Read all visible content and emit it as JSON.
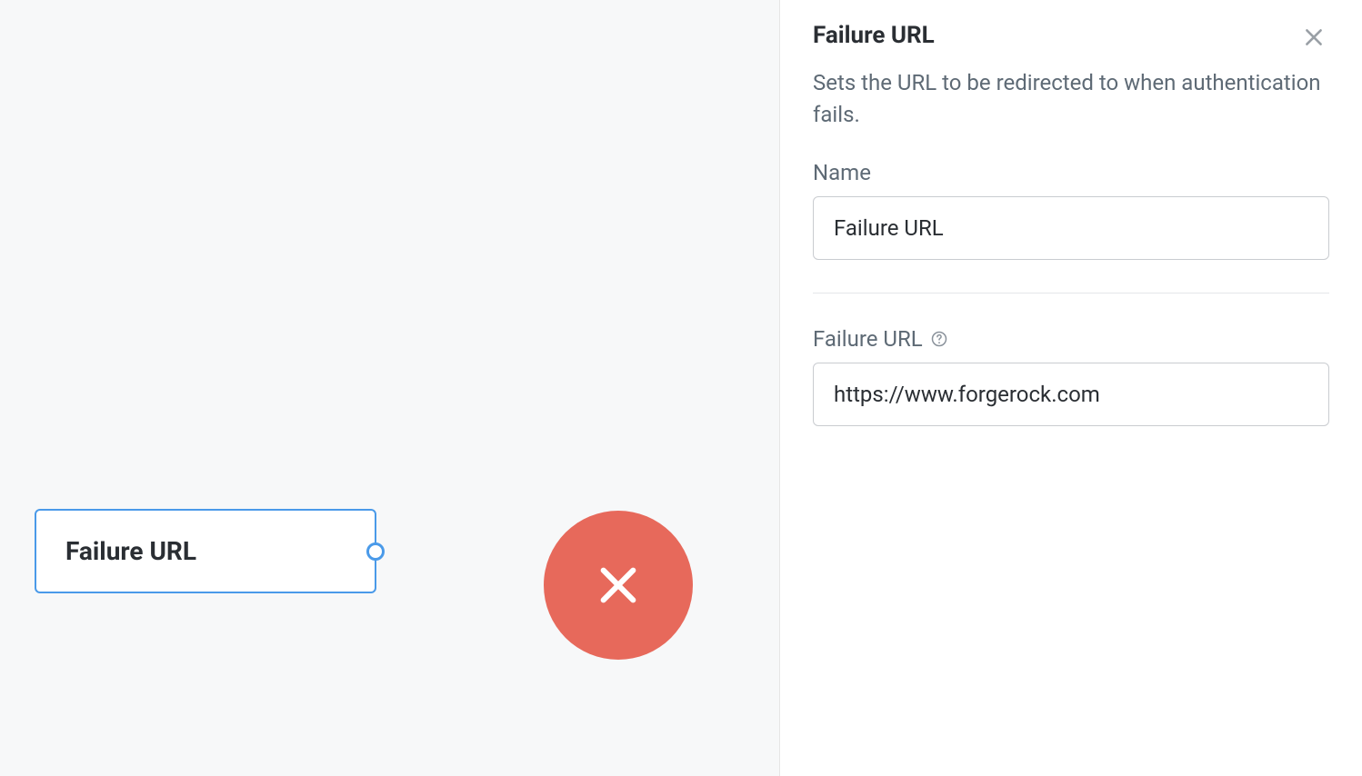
{
  "panel": {
    "title": "Failure URL",
    "description": "Sets the URL to be redirected to when authentication fails.",
    "name_label": "Name",
    "name_value": "Failure URL",
    "url_label": "Failure URL",
    "url_value": "https://www.forgerock.com"
  },
  "canvas": {
    "node_label": "Failure URL"
  }
}
